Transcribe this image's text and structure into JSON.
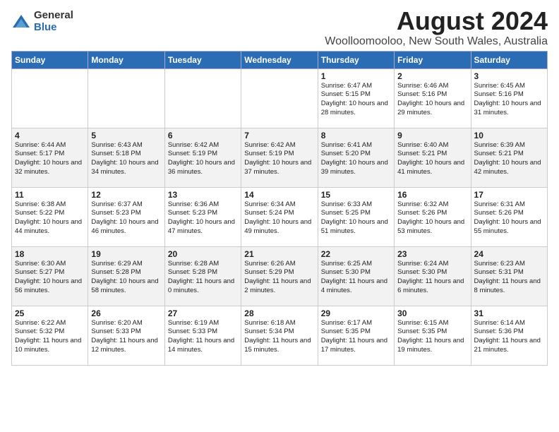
{
  "logo": {
    "general": "General",
    "blue": "Blue"
  },
  "title": "August 2024",
  "subtitle": "Woolloomooloo, New South Wales, Australia",
  "headers": [
    "Sunday",
    "Monday",
    "Tuesday",
    "Wednesday",
    "Thursday",
    "Friday",
    "Saturday"
  ],
  "weeks": [
    [
      {
        "day": "",
        "sunrise": "",
        "sunset": "",
        "daylight": ""
      },
      {
        "day": "",
        "sunrise": "",
        "sunset": "",
        "daylight": ""
      },
      {
        "day": "",
        "sunrise": "",
        "sunset": "",
        "daylight": ""
      },
      {
        "day": "",
        "sunrise": "",
        "sunset": "",
        "daylight": ""
      },
      {
        "day": "1",
        "sunrise": "Sunrise: 6:47 AM",
        "sunset": "Sunset: 5:15 PM",
        "daylight": "Daylight: 10 hours and 28 minutes."
      },
      {
        "day": "2",
        "sunrise": "Sunrise: 6:46 AM",
        "sunset": "Sunset: 5:16 PM",
        "daylight": "Daylight: 10 hours and 29 minutes."
      },
      {
        "day": "3",
        "sunrise": "Sunrise: 6:45 AM",
        "sunset": "Sunset: 5:16 PM",
        "daylight": "Daylight: 10 hours and 31 minutes."
      }
    ],
    [
      {
        "day": "4",
        "sunrise": "Sunrise: 6:44 AM",
        "sunset": "Sunset: 5:17 PM",
        "daylight": "Daylight: 10 hours and 32 minutes."
      },
      {
        "day": "5",
        "sunrise": "Sunrise: 6:43 AM",
        "sunset": "Sunset: 5:18 PM",
        "daylight": "Daylight: 10 hours and 34 minutes."
      },
      {
        "day": "6",
        "sunrise": "Sunrise: 6:42 AM",
        "sunset": "Sunset: 5:19 PM",
        "daylight": "Daylight: 10 hours and 36 minutes."
      },
      {
        "day": "7",
        "sunrise": "Sunrise: 6:42 AM",
        "sunset": "Sunset: 5:19 PM",
        "daylight": "Daylight: 10 hours and 37 minutes."
      },
      {
        "day": "8",
        "sunrise": "Sunrise: 6:41 AM",
        "sunset": "Sunset: 5:20 PM",
        "daylight": "Daylight: 10 hours and 39 minutes."
      },
      {
        "day": "9",
        "sunrise": "Sunrise: 6:40 AM",
        "sunset": "Sunset: 5:21 PM",
        "daylight": "Daylight: 10 hours and 41 minutes."
      },
      {
        "day": "10",
        "sunrise": "Sunrise: 6:39 AM",
        "sunset": "Sunset: 5:21 PM",
        "daylight": "Daylight: 10 hours and 42 minutes."
      }
    ],
    [
      {
        "day": "11",
        "sunrise": "Sunrise: 6:38 AM",
        "sunset": "Sunset: 5:22 PM",
        "daylight": "Daylight: 10 hours and 44 minutes."
      },
      {
        "day": "12",
        "sunrise": "Sunrise: 6:37 AM",
        "sunset": "Sunset: 5:23 PM",
        "daylight": "Daylight: 10 hours and 46 minutes."
      },
      {
        "day": "13",
        "sunrise": "Sunrise: 6:36 AM",
        "sunset": "Sunset: 5:23 PM",
        "daylight": "Daylight: 10 hours and 47 minutes."
      },
      {
        "day": "14",
        "sunrise": "Sunrise: 6:34 AM",
        "sunset": "Sunset: 5:24 PM",
        "daylight": "Daylight: 10 hours and 49 minutes."
      },
      {
        "day": "15",
        "sunrise": "Sunrise: 6:33 AM",
        "sunset": "Sunset: 5:25 PM",
        "daylight": "Daylight: 10 hours and 51 minutes."
      },
      {
        "day": "16",
        "sunrise": "Sunrise: 6:32 AM",
        "sunset": "Sunset: 5:26 PM",
        "daylight": "Daylight: 10 hours and 53 minutes."
      },
      {
        "day": "17",
        "sunrise": "Sunrise: 6:31 AM",
        "sunset": "Sunset: 5:26 PM",
        "daylight": "Daylight: 10 hours and 55 minutes."
      }
    ],
    [
      {
        "day": "18",
        "sunrise": "Sunrise: 6:30 AM",
        "sunset": "Sunset: 5:27 PM",
        "daylight": "Daylight: 10 hours and 56 minutes."
      },
      {
        "day": "19",
        "sunrise": "Sunrise: 6:29 AM",
        "sunset": "Sunset: 5:28 PM",
        "daylight": "Daylight: 10 hours and 58 minutes."
      },
      {
        "day": "20",
        "sunrise": "Sunrise: 6:28 AM",
        "sunset": "Sunset: 5:28 PM",
        "daylight": "Daylight: 11 hours and 0 minutes."
      },
      {
        "day": "21",
        "sunrise": "Sunrise: 6:26 AM",
        "sunset": "Sunset: 5:29 PM",
        "daylight": "Daylight: 11 hours and 2 minutes."
      },
      {
        "day": "22",
        "sunrise": "Sunrise: 6:25 AM",
        "sunset": "Sunset: 5:30 PM",
        "daylight": "Daylight: 11 hours and 4 minutes."
      },
      {
        "day": "23",
        "sunrise": "Sunrise: 6:24 AM",
        "sunset": "Sunset: 5:30 PM",
        "daylight": "Daylight: 11 hours and 6 minutes."
      },
      {
        "day": "24",
        "sunrise": "Sunrise: 6:23 AM",
        "sunset": "Sunset: 5:31 PM",
        "daylight": "Daylight: 11 hours and 8 minutes."
      }
    ],
    [
      {
        "day": "25",
        "sunrise": "Sunrise: 6:22 AM",
        "sunset": "Sunset: 5:32 PM",
        "daylight": "Daylight: 11 hours and 10 minutes."
      },
      {
        "day": "26",
        "sunrise": "Sunrise: 6:20 AM",
        "sunset": "Sunset: 5:33 PM",
        "daylight": "Daylight: 11 hours and 12 minutes."
      },
      {
        "day": "27",
        "sunrise": "Sunrise: 6:19 AM",
        "sunset": "Sunset: 5:33 PM",
        "daylight": "Daylight: 11 hours and 14 minutes."
      },
      {
        "day": "28",
        "sunrise": "Sunrise: 6:18 AM",
        "sunset": "Sunset: 5:34 PM",
        "daylight": "Daylight: 11 hours and 15 minutes."
      },
      {
        "day": "29",
        "sunrise": "Sunrise: 6:17 AM",
        "sunset": "Sunset: 5:35 PM",
        "daylight": "Daylight: 11 hours and 17 minutes."
      },
      {
        "day": "30",
        "sunrise": "Sunrise: 6:15 AM",
        "sunset": "Sunset: 5:35 PM",
        "daylight": "Daylight: 11 hours and 19 minutes."
      },
      {
        "day": "31",
        "sunrise": "Sunrise: 6:14 AM",
        "sunset": "Sunset: 5:36 PM",
        "daylight": "Daylight: 11 hours and 21 minutes."
      }
    ]
  ]
}
